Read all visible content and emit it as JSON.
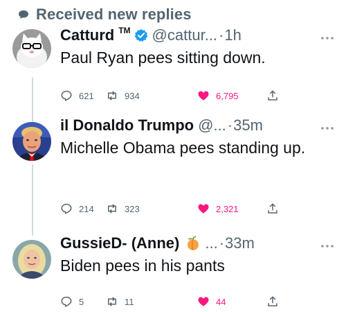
{
  "header": {
    "text": "Received new replies",
    "icon": "speech-bubble-icon"
  },
  "colors": {
    "like": "#f91880",
    "secondary_text": "#536471",
    "verified": "#1d9bf0",
    "thread_line": "#cfd9de"
  },
  "tweets": [
    {
      "display_name": "Catturd",
      "name_badge": "TM",
      "verified": true,
      "handle": "@cattur...",
      "separator": "·",
      "time": "1h",
      "text": "Paul Ryan pees sitting down.",
      "replies": "621",
      "retweets": "934",
      "likes": "6,795",
      "liked": true
    },
    {
      "display_name": "il Donaldo Trumpo",
      "handle": "@...",
      "separator": "·",
      "time": "35m",
      "text": "Michelle Obama pees standing up.",
      "replies": "214",
      "retweets": "323",
      "likes": "2,321",
      "liked": true
    },
    {
      "display_name": "GussieD- (Anne)",
      "name_emoji": "peach-icon",
      "handle": "...",
      "separator": "·",
      "time": "33m",
      "text": "Biden pees in his pants",
      "replies": "5",
      "retweets": "11",
      "likes": "44",
      "liked": true
    }
  ]
}
